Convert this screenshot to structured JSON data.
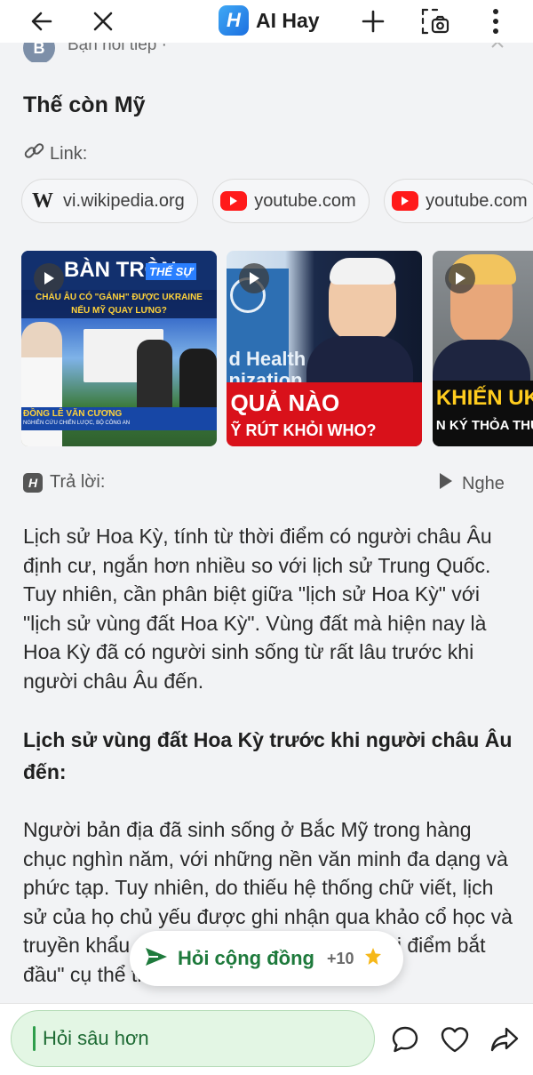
{
  "header": {
    "brand_logo_letter": "H",
    "brand_name": "AI Hay"
  },
  "peek": {
    "avatar_letter": "B",
    "text": "Bạn hỏi tiếp ·"
  },
  "question": "Thế còn Mỹ",
  "links": {
    "label": "Link:",
    "chips": [
      {
        "icon": "wikipedia-icon",
        "label": "vi.wikipedia.org"
      },
      {
        "icon": "youtube-icon",
        "label": "youtube.com"
      },
      {
        "icon": "youtube-icon",
        "label": "youtube.com"
      }
    ]
  },
  "videos": [
    {
      "title_line1": "BÀN TRÒN",
      "tag": "THẾ SỰ",
      "subtitle": "CHÂU ÂU CÓ \"GÁNH\" ĐƯỢC UKRAINE NẾU MỸ QUAY LƯNG?",
      "speaker": "ĐỒNG LÊ VĂN CƯƠNG",
      "speaker_sub": "NGHIÊN CỨU CHIẾN LƯỢC, BỘ CÔNG AN"
    },
    {
      "sign": "d Health\nnization",
      "caption1": "QUẢ NÀO",
      "caption2": "Ỹ RÚT KHỎI WHO?"
    },
    {
      "caption1": "KHIẾN UKRA",
      "caption2": "N KÝ THỎA THU"
    }
  ],
  "answer": {
    "label": "Trả lời:",
    "listen_label": "Nghe",
    "paragraph1": "Lịch sử Hoa Kỳ, tính từ thời điểm có người châu Âu định cư, ngắn hơn nhiều so với lịch sử Trung Quốc.  Tuy nhiên, cần phân biệt giữa \"lịch sử Hoa Kỳ\" với \"lịch sử vùng đất Hoa Kỳ\". Vùng đất mà hiện nay là Hoa Kỳ đã có người sinh sống từ rất lâu trước khi người châu Âu đến.",
    "heading": "Lịch sử vùng đất Hoa Kỳ trước khi người châu Âu đến:",
    "paragraph2": "Người bản địa đã sinh sống ở Bắc Mỹ trong hàng chục nghìn năm, với những nền văn minh đa dạng và phức tạp.  Tuy nhiên, do thiếu hệ thống chữ viết, lịch sử của họ chủ yếu được ghi nhận qua khảo cổ học và truyền khẩu, khiến việc xác định một \"thời điểm bắt đầu\" cụ thể trở nên khó khăn."
  },
  "community_button": {
    "label": "Hỏi cộng đồng",
    "bonus": "+10"
  },
  "bottom": {
    "ask_label": "Hỏi sâu hơn"
  },
  "colors": {
    "brand_blue": "#1c6fe0",
    "accent_green": "#1e7a3c",
    "youtube_red": "#ff1a1a"
  }
}
